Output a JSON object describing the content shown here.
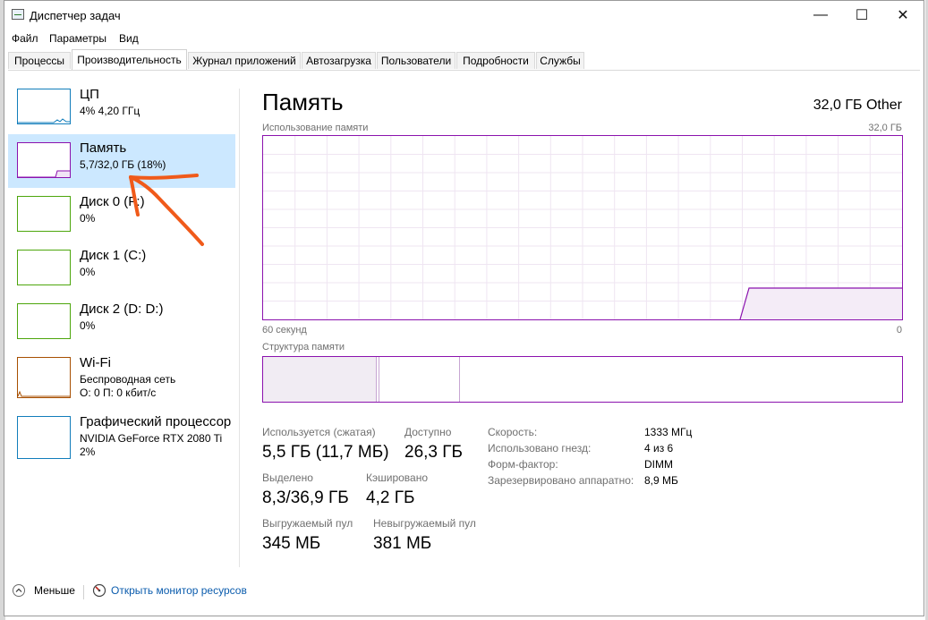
{
  "window": {
    "title": "Диспетчер задач",
    "minimize_glyph": "—",
    "maximize_glyph": "☐",
    "close_glyph": "✕"
  },
  "menu": [
    "Файл",
    "Параметры",
    "Вид"
  ],
  "tabs": [
    "Процессы",
    "Производительность",
    "Журнал приложений",
    "Автозагрузка",
    "Пользователи",
    "Подробности",
    "Службы"
  ],
  "active_tab": "Производительность",
  "resources": [
    {
      "title": "ЦП",
      "sub1": "4% 4,20 ГГц",
      "sub2": "",
      "color": "#117dbb"
    },
    {
      "title": "Память",
      "sub1": "5,7/32,0 ГБ (18%)",
      "sub2": "",
      "color": "#8b12ae"
    },
    {
      "title": "Диск 0 (F:)",
      "sub1": "0%",
      "sub2": "",
      "color": "#4da60c"
    },
    {
      "title": "Диск 1 (C:)",
      "sub1": "0%",
      "sub2": "",
      "color": "#4da60c"
    },
    {
      "title": "Диск 2 (D: D:)",
      "sub1": "0%",
      "sub2": "",
      "color": "#4da60c"
    },
    {
      "title": "Wi-Fi",
      "sub1": "Беспроводная сеть",
      "sub2": "О: 0 П: 0 кбит/с",
      "color": "#a74f01"
    },
    {
      "title": "Графический процессор",
      "sub1": "NVIDIA GeForce RTX 2080 Ti",
      "sub2": "2%",
      "color": "#117dbb"
    }
  ],
  "memory": {
    "title": "Память",
    "total": "32,0 ГБ Other",
    "usage_label": "Использование памяти",
    "usage_max": "32,0 ГБ",
    "time_left": "60 секунд",
    "time_right": "0",
    "composition_label": "Структура памяти",
    "stats": {
      "in_use_label": "Используется (сжатая)",
      "in_use_value": "5,5 ГБ (11,7 МБ)",
      "available_label": "Доступно",
      "available_value": "26,3 ГБ",
      "committed_label": "Выделено",
      "committed_value": "8,3/36,9 ГБ",
      "cached_label": "Кэшировано",
      "cached_value": "4,2 ГБ",
      "paged_label": "Выгружаемый пул",
      "paged_value": "345 МБ",
      "nonpaged_label": "Невыгружаемый пул",
      "nonpaged_value": "381 МБ"
    },
    "details": [
      {
        "label": "Скорость:",
        "value": "1333 МГц"
      },
      {
        "label": "Использовано гнезд:",
        "value": "4 из 6"
      },
      {
        "label": "Форм-фактор:",
        "value": "DIMM"
      },
      {
        "label": "Зарезервировано аппаратно:",
        "value": "8,9 МБ"
      }
    ]
  },
  "bottom": {
    "less": "Меньше",
    "monitor_link": "Открыть монитор ресурсов"
  },
  "annotation_color": "#f05a1a"
}
